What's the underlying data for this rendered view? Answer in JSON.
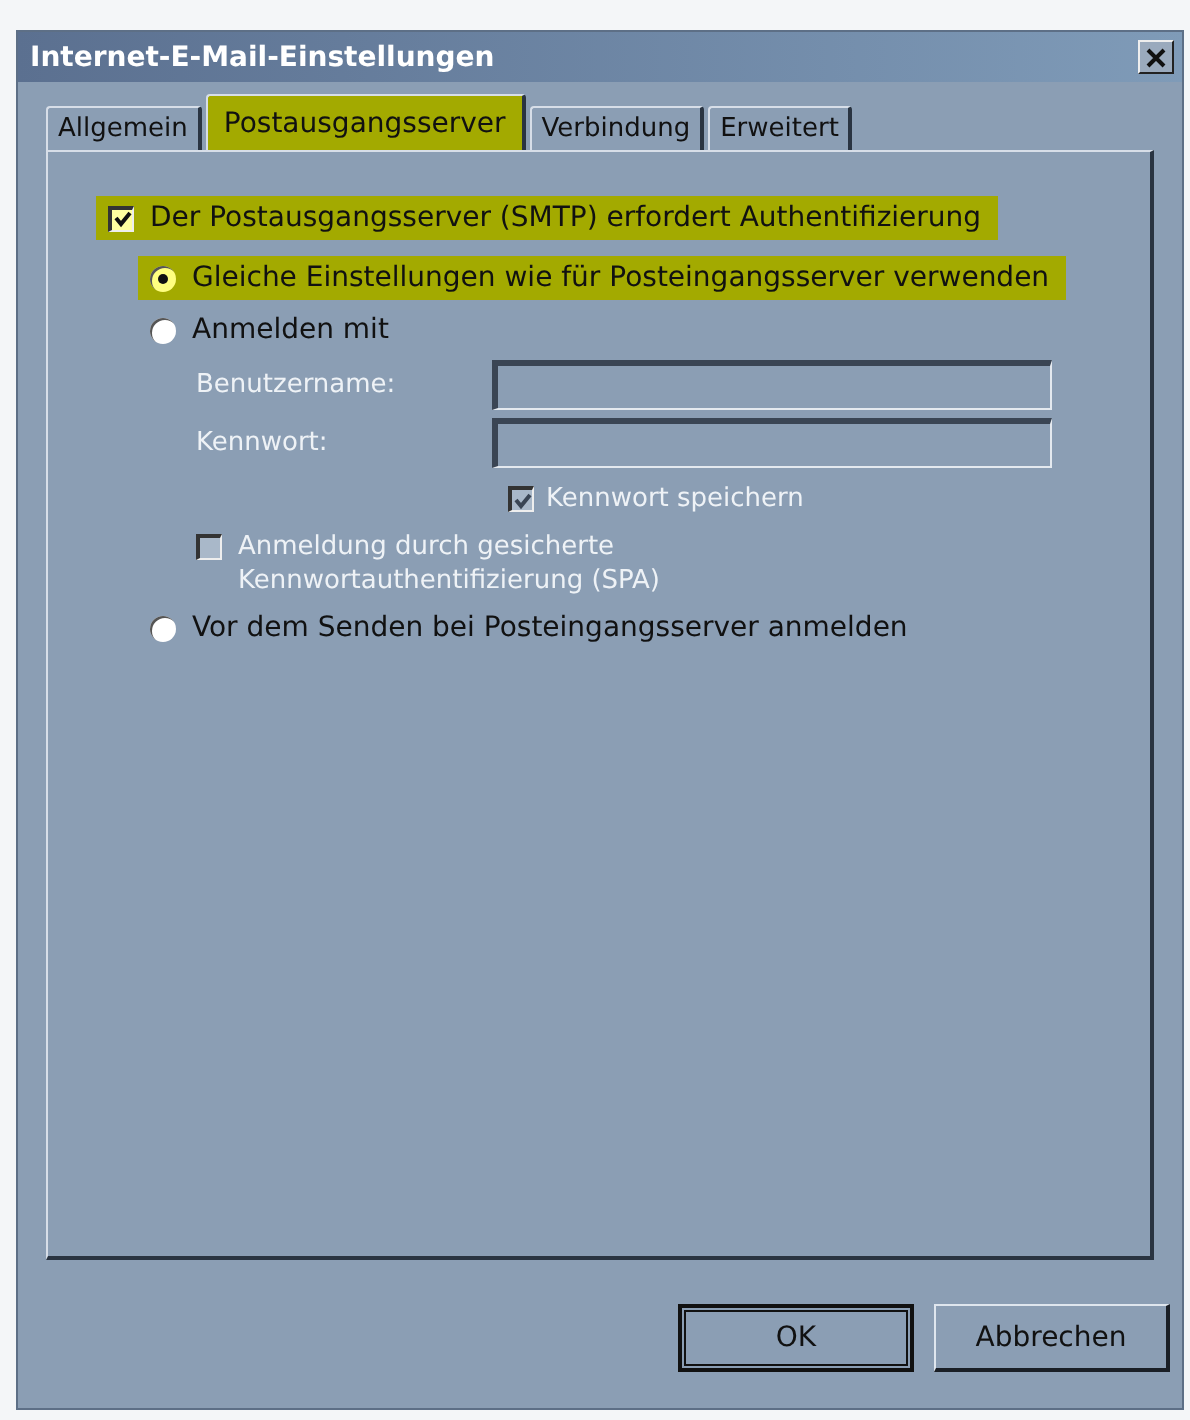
{
  "window": {
    "title": "Internet-E-Mail-Einstellungen"
  },
  "tabs": [
    {
      "label": "Allgemein",
      "selected": false,
      "highlighted": false
    },
    {
      "label": "Postausgangsserver",
      "selected": true,
      "highlighted": true
    },
    {
      "label": "Verbindung",
      "selected": false,
      "highlighted": false
    },
    {
      "label": "Erweitert",
      "selected": false,
      "highlighted": false
    }
  ],
  "auth": {
    "label": "Der Postausgangsserver (SMTP) erfordert Authentifizierung",
    "checked": true,
    "highlighted": true
  },
  "options": [
    {
      "kind": "radio",
      "label": "Gleiche Einstellungen wie für Posteingangsserver verwenden",
      "selected": true,
      "highlighted": true
    },
    {
      "kind": "radio",
      "label": "Anmelden mit",
      "selected": false,
      "highlighted": false
    },
    {
      "kind": "field",
      "label": "Benutzername:",
      "disabled": true
    },
    {
      "kind": "field",
      "label": "Kennwort:",
      "disabled": true
    },
    {
      "kind": "fieldcheck",
      "label": "Kennwort speichern",
      "checked": true,
      "disabled": true
    },
    {
      "kind": "check",
      "label": "Anmeldung durch gesicherte Kennwortauthentifizierung (SPA)",
      "checked": false,
      "disabled": true
    },
    {
      "kind": "radio",
      "label": "Vor dem Senden bei Posteingangsserver anmelden",
      "selected": false,
      "highlighted": false
    }
  ],
  "buttons": [
    {
      "label": "OK",
      "default": true
    },
    {
      "label": "Abbrechen",
      "default": false
    }
  ]
}
